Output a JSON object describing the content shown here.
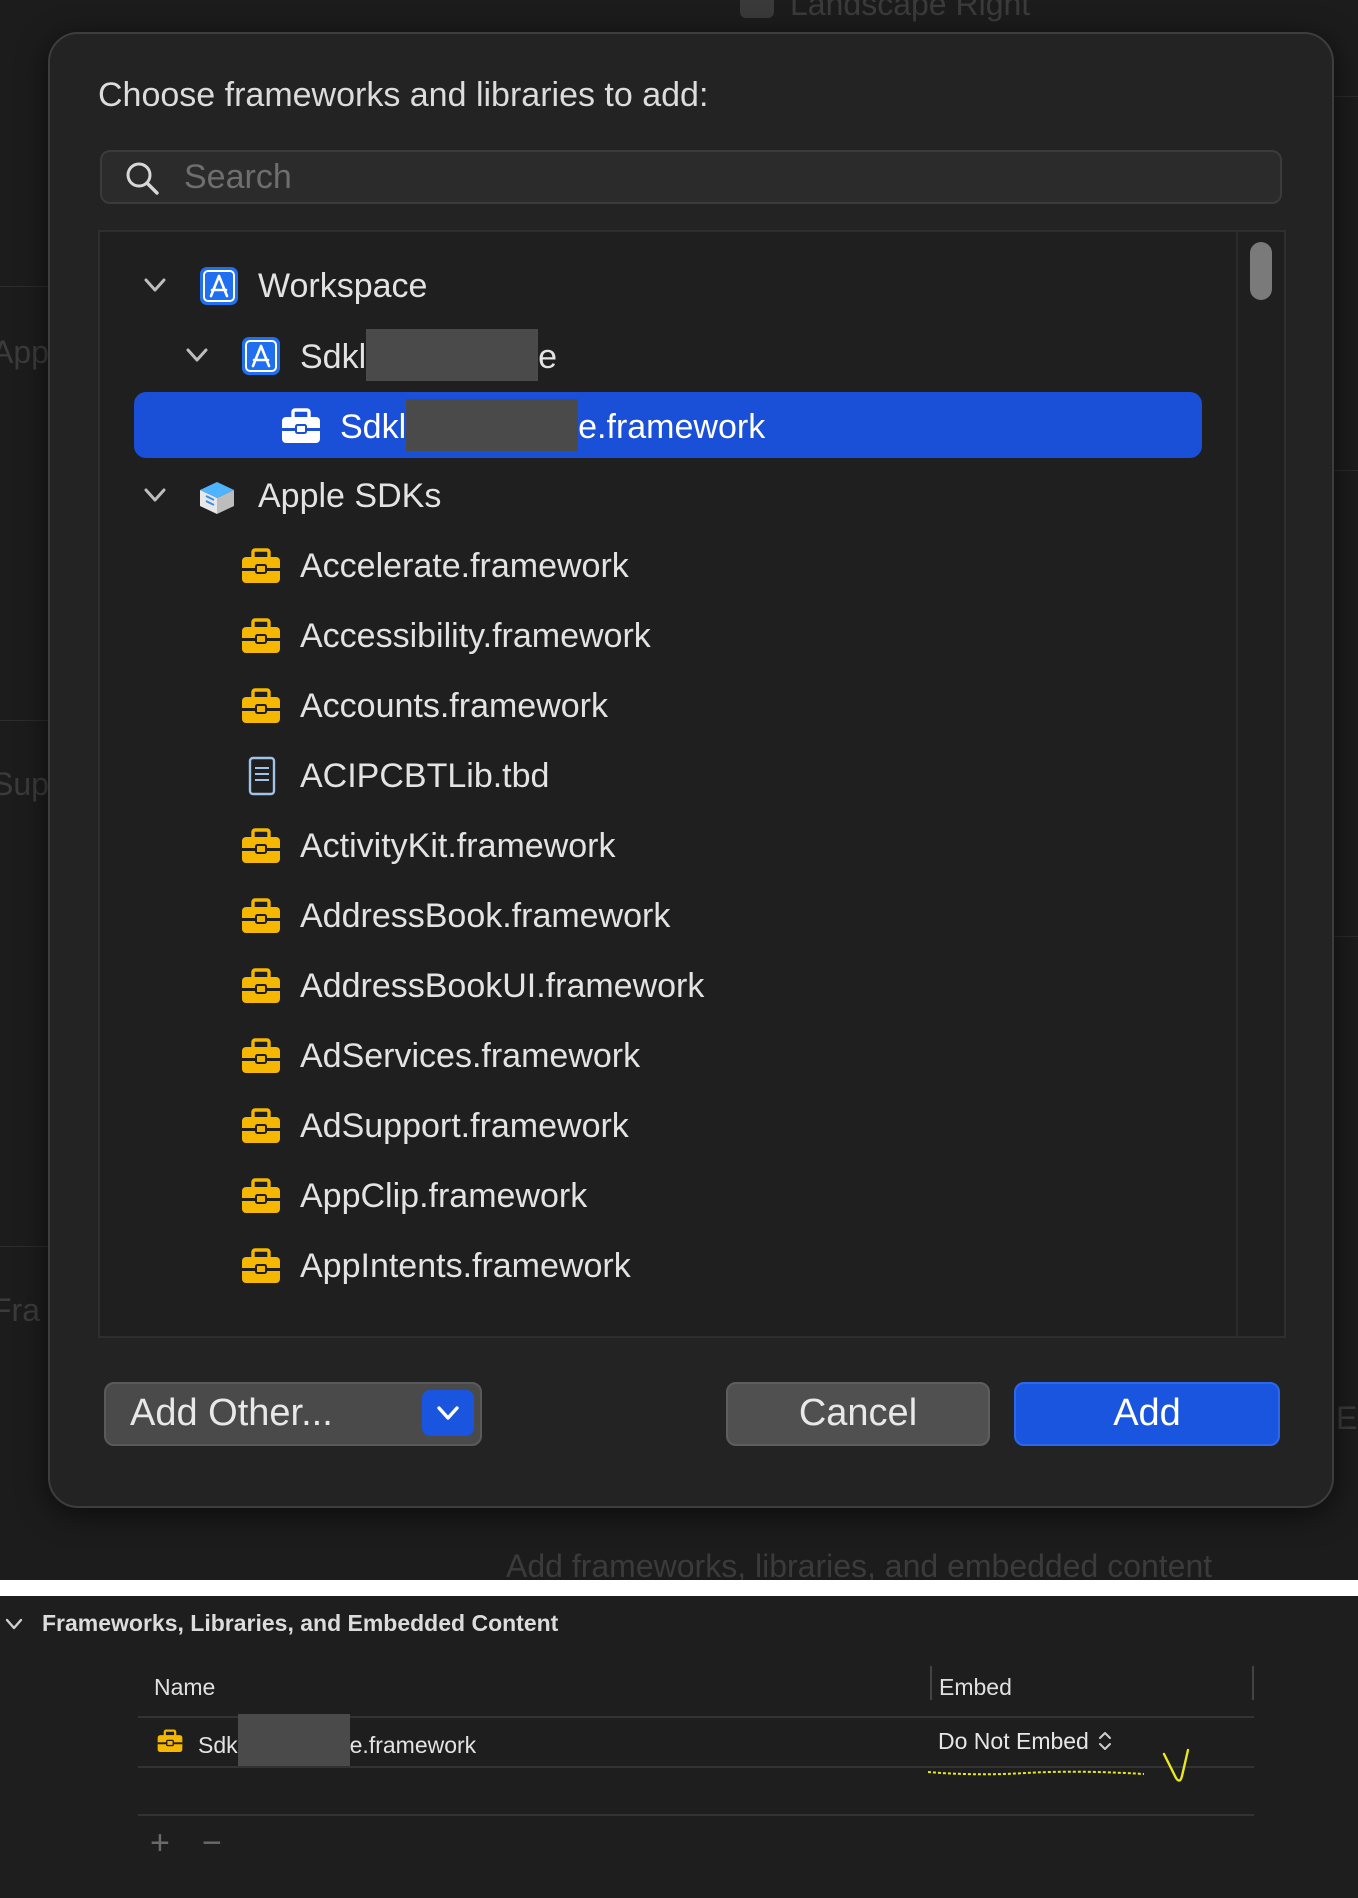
{
  "background": {
    "top_check_label": "Landscape Right",
    "side_fragments": [
      "App",
      "Sup",
      "Fra"
    ],
    "right_fragment": "E",
    "bottom_hint": "Add frameworks, libraries, and embedded content"
  },
  "dialog": {
    "title": "Choose frameworks and libraries to add:",
    "search": {
      "placeholder": "Search",
      "value": ""
    },
    "tree": [
      {
        "label": "Workspace",
        "icon": "xcode-app-icon",
        "expanded": true
      },
      {
        "label_prefix": "Sdkl",
        "label_suffix": "e",
        "icon": "xcode-app-icon",
        "expanded": true
      },
      {
        "label_prefix": "Sdkl",
        "label_suffix": "e.framework",
        "icon": "framework-icon",
        "selected": true
      },
      {
        "label": "Apple SDKs",
        "icon": "sdk-box-icon",
        "expanded": true
      },
      {
        "label": "Accelerate.framework",
        "icon": "framework-icon"
      },
      {
        "label": "Accessibility.framework",
        "icon": "framework-icon"
      },
      {
        "label": "Accounts.framework",
        "icon": "framework-icon"
      },
      {
        "label": "ACIPCBTLib.tbd",
        "icon": "tbd-file-icon"
      },
      {
        "label": "ActivityKit.framework",
        "icon": "framework-icon"
      },
      {
        "label": "AddressBook.framework",
        "icon": "framework-icon"
      },
      {
        "label": "AddressBookUI.framework",
        "icon": "framework-icon"
      },
      {
        "label": "AdServices.framework",
        "icon": "framework-icon"
      },
      {
        "label": "AdSupport.framework",
        "icon": "framework-icon"
      },
      {
        "label": "AppClip.framework",
        "icon": "framework-icon"
      },
      {
        "label": "AppIntents.framework",
        "icon": "framework-icon"
      }
    ],
    "buttons": {
      "add_other": "Add Other...",
      "cancel": "Cancel",
      "add": "Add"
    }
  },
  "bottom": {
    "section_title": "Frameworks, Libraries, and Embedded Content",
    "table": {
      "headers": {
        "name": "Name",
        "embed": "Embed"
      },
      "rows": [
        {
          "name_prefix": "Sdk",
          "name_suffix": "e.framework",
          "embed": "Do Not Embed"
        }
      ]
    },
    "toolbar": {
      "add": "+",
      "remove": "−"
    }
  },
  "colors": {
    "selection": "#1a4fd8",
    "primary_button": "#1a55e0",
    "framework_icon": "#f5b700",
    "annotation": "#e8e820"
  }
}
